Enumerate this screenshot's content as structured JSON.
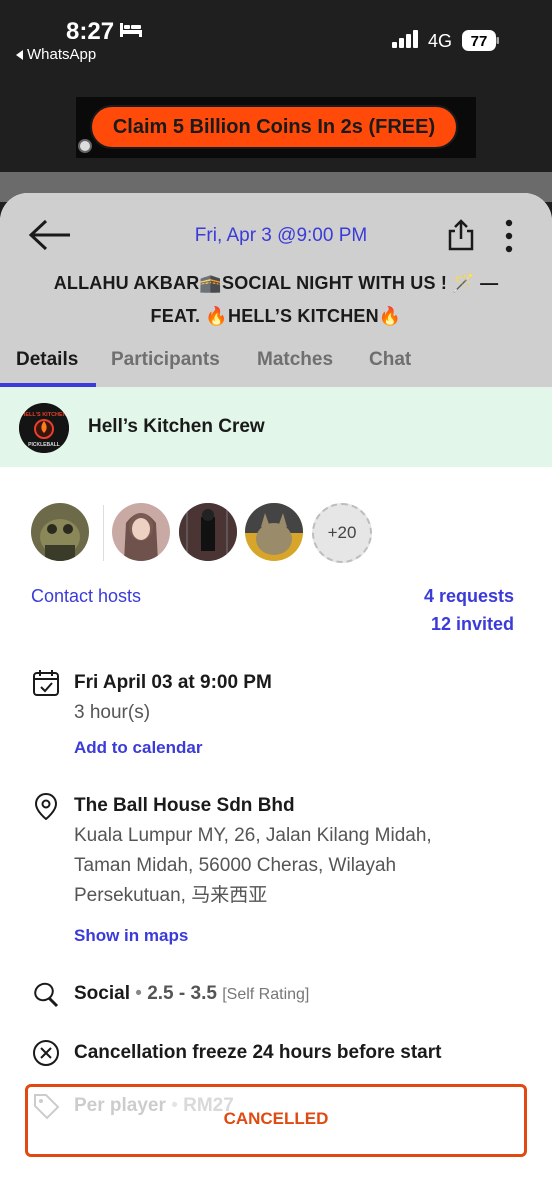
{
  "status_bar": {
    "time": "8:27",
    "back_app": "WhatsApp",
    "network": "4G",
    "battery": "77"
  },
  "ad": {
    "text": "Claim 5 Billion Coins In 2s (FREE)",
    "pill_color": "#ff4a0a"
  },
  "header": {
    "date": "Fri, Apr 3 @9:00 PM",
    "title_line1": "ALLAHU AKBAR🕋SOCIAL NIGHT WITH US ! 🪄 —",
    "title_line2": "FEAT. 🔥HELL’S KITCHEN🔥"
  },
  "tabs": [
    {
      "label": "Details",
      "active": true
    },
    {
      "label": "Participants",
      "active": false
    },
    {
      "label": "Matches",
      "active": false
    },
    {
      "label": "Chat",
      "active": false
    }
  ],
  "crew": {
    "name": "Hell’s Kitchen Crew",
    "logo_text_top": "HELL'S KITCHEN",
    "logo_text_bottom": "PICKLEBALL"
  },
  "participants": {
    "more_count": "+20"
  },
  "hosts": {
    "contact_label": "Contact hosts",
    "requests": "4 requests",
    "invited": "12 invited"
  },
  "schedule": {
    "icon": "calendar-check-icon",
    "datetime": "Fri April 03 at 9:00 PM",
    "duration": "3 hour(s)",
    "add_calendar": "Add to calendar"
  },
  "location": {
    "icon": "map-pin-icon",
    "venue": "The Ball House Sdn Bhd",
    "address_line1": "Kuala Lumpur MY, 26, Jalan Kilang Midah,",
    "address_line2": "Taman Midah, 56000 Cheras, Wilayah",
    "address_line3": "Persekutuan, 马来西亚",
    "maps_link": "Show in maps"
  },
  "game": {
    "icon": "paddle-icon",
    "type": "Social",
    "separator": "•",
    "rating": "2.5 - 3.5",
    "rating_tag": "[Self Rating]"
  },
  "cancellation": {
    "icon": "x-circle-icon",
    "text": "Cancellation freeze 24 hours before start"
  },
  "price": {
    "icon": "tag-icon",
    "label": "Per player",
    "separator": "•",
    "amount": "RM27"
  },
  "status": {
    "label": "CANCELLED",
    "color": "#e04a10"
  },
  "colors": {
    "accent": "#3b3bd9",
    "crew_bg": "#e2f6ea"
  }
}
